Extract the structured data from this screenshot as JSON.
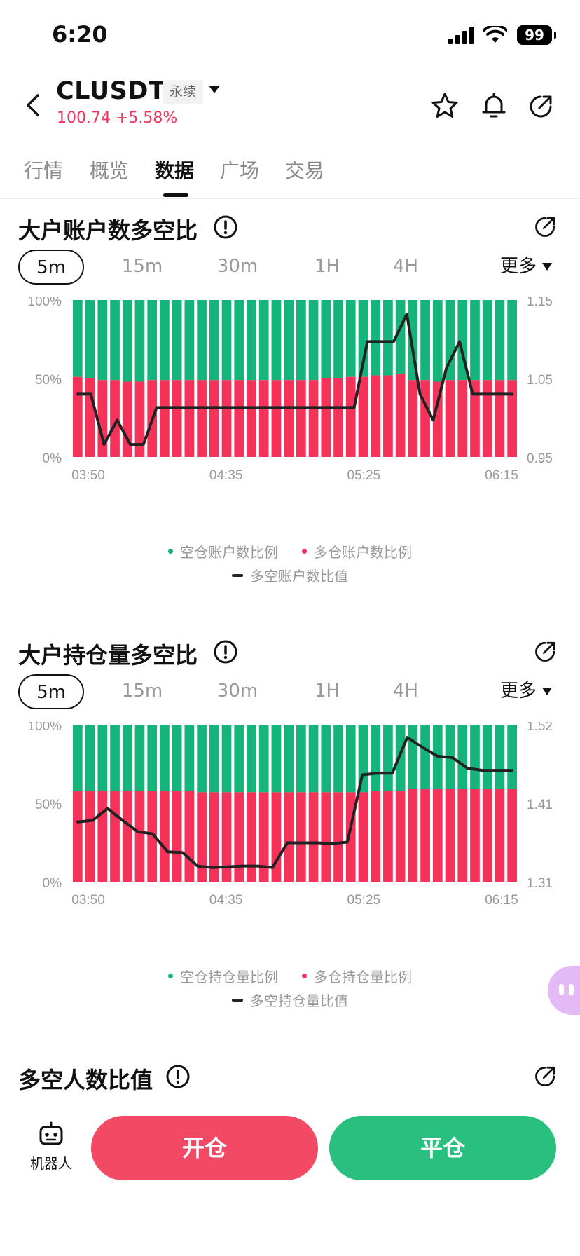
{
  "status_bar": {
    "time": "6:20",
    "battery": "99"
  },
  "header": {
    "symbol": "CLUSDT",
    "tag": "永续",
    "price": "100.74",
    "change": "+5.58%"
  },
  "tabs": [
    {
      "label": "行情",
      "active": false
    },
    {
      "label": "概览",
      "active": false
    },
    {
      "label": "数据",
      "active": true
    },
    {
      "label": "广场",
      "active": false
    },
    {
      "label": "交易",
      "active": false
    }
  ],
  "periods": [
    "5m",
    "15m",
    "30m",
    "1H",
    "4H"
  ],
  "more_label": "更多",
  "sections": [
    {
      "title": "大户账户数多空比"
    },
    {
      "title": "大户持仓量多空比"
    },
    {
      "title": "多空人数比值"
    }
  ],
  "colors": {
    "short": "#14b47a",
    "long": "#f5335a",
    "ratio": "#222222",
    "up": "#f0345c"
  },
  "chart_data": [
    {
      "type": "bar",
      "stacked": true,
      "x_ticks": [
        "03:50",
        "04:35",
        "05:25",
        "06:15"
      ],
      "left_ticks": [
        "100%",
        "50%",
        "0%"
      ],
      "right_ticks": [
        "1.15",
        "1.05",
        "0.95"
      ],
      "ylim_left": [
        0,
        100
      ],
      "ylim_right": [
        0.95,
        1.15
      ],
      "series": [
        {
          "name": "空仓账户数比例",
          "values": [
            49,
            50,
            51,
            51,
            52,
            52,
            51,
            51,
            51,
            51,
            51,
            51,
            51,
            51,
            51,
            51,
            51,
            51,
            51,
            51,
            50,
            50,
            49,
            49,
            48,
            48,
            47,
            51,
            51,
            52,
            51,
            51,
            51,
            51,
            51,
            51
          ]
        },
        {
          "name": "多仓账户数比例",
          "values": [
            51,
            50,
            49,
            49,
            48,
            48,
            49,
            49,
            49,
            49,
            49,
            49,
            49,
            49,
            49,
            49,
            49,
            49,
            49,
            49,
            50,
            50,
            51,
            51,
            52,
            52,
            53,
            49,
            49,
            48,
            49,
            49,
            49,
            49,
            49,
            49
          ]
        },
        {
          "name": "多空账户数比值",
          "values": [
            1.03,
            1.03,
            0.966,
            0.997,
            0.966,
            0.966,
            1.013,
            1.013,
            1.013,
            1.013,
            1.013,
            1.013,
            1.013,
            1.013,
            1.013,
            1.013,
            1.013,
            1.013,
            1.013,
            1.013,
            1.013,
            1.013,
            1.097,
            1.097,
            1.097,
            1.132,
            1.03,
            0.997,
            1.063,
            1.097,
            1.03,
            1.03,
            1.03,
            1.03
          ]
        }
      ]
    },
    {
      "type": "bar",
      "stacked": true,
      "x_ticks": [
        "03:50",
        "04:35",
        "05:25",
        "06:15"
      ],
      "left_ticks": [
        "100%",
        "50%",
        "0%"
      ],
      "right_ticks": [
        "1.52",
        "1.41",
        "1.31"
      ],
      "ylim_left": [
        0,
        100
      ],
      "ylim_right": [
        1.31,
        1.52
      ],
      "series": [
        {
          "name": "空仓持仓量比例",
          "values": [
            42,
            42,
            42,
            42,
            42,
            42,
            42,
            42,
            42,
            42,
            43,
            43,
            43,
            43,
            43,
            43,
            43,
            43,
            43,
            43,
            43,
            43,
            43,
            43,
            42,
            42,
            42,
            41,
            41,
            41,
            41,
            41,
            41,
            41,
            41,
            41
          ]
        },
        {
          "name": "多仓持仓量比例",
          "values": [
            58,
            58,
            58,
            58,
            58,
            58,
            58,
            58,
            58,
            58,
            57,
            57,
            57,
            57,
            57,
            57,
            57,
            57,
            57,
            57,
            57,
            57,
            57,
            57,
            58,
            58,
            58,
            59,
            59,
            59,
            59,
            59,
            59,
            59,
            59,
            59
          ]
        },
        {
          "name": "多空持仓量比值",
          "values": [
            1.39,
            1.392,
            1.408,
            1.392,
            1.377,
            1.374,
            1.35,
            1.349,
            1.331,
            1.329,
            1.33,
            1.331,
            1.331,
            1.329,
            1.362,
            1.362,
            1.362,
            1.361,
            1.363,
            1.453,
            1.455,
            1.455,
            1.503,
            1.49,
            1.478,
            1.476,
            1.462,
            1.459,
            1.459,
            1.459
          ]
        }
      ]
    }
  ],
  "bottom": {
    "robot_label": "机器人",
    "open_label": "开仓",
    "close_label": "平仓"
  }
}
